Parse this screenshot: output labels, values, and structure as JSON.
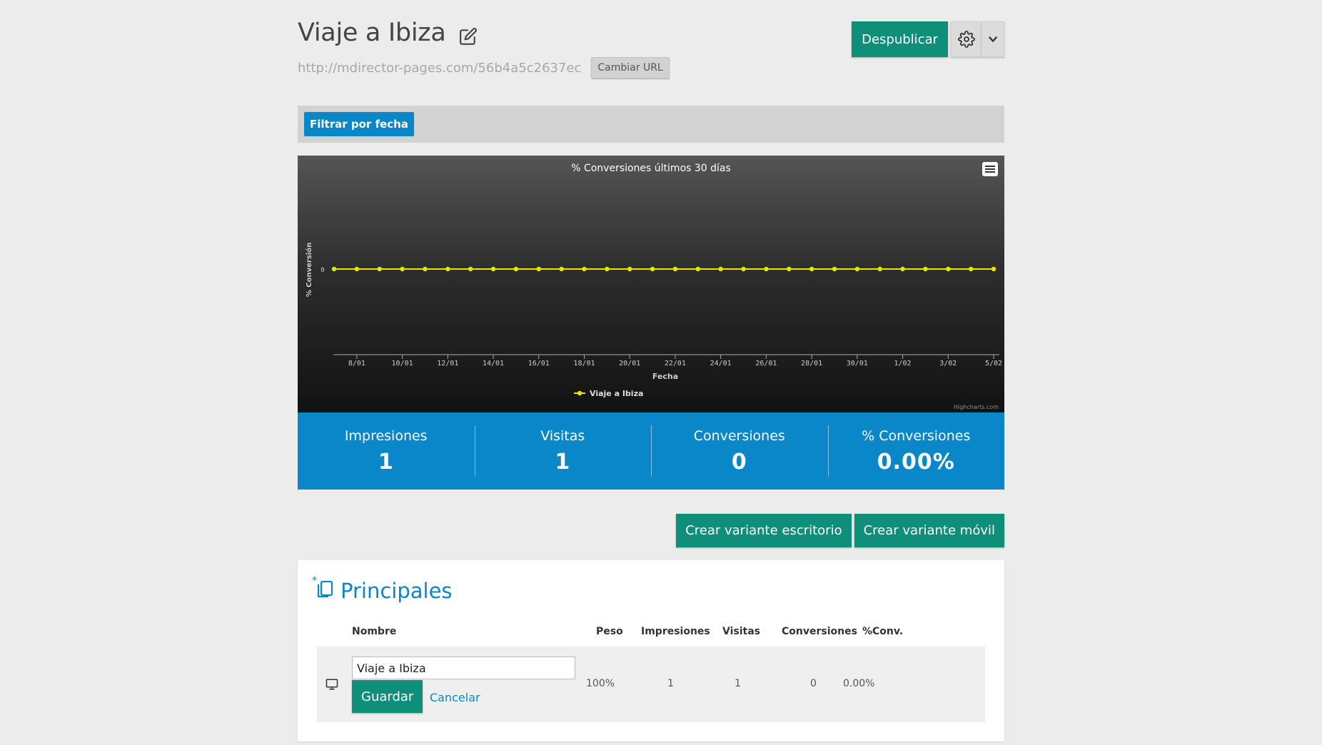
{
  "header": {
    "title": "Viaje a Ibiza",
    "url": "http://mdirector-pages.com/56b4a5c2637ec",
    "change_url_label": "Cambiar URL",
    "unpublish_label": "Despublicar"
  },
  "filter": {
    "button_label": "Filtrar por fecha"
  },
  "chart_data": {
    "type": "line",
    "title": "% Conversiones últimos 30 días",
    "xlabel": "Fecha",
    "ylabel": "% Conversión",
    "ytick": "0",
    "credits": "Highcharts.com",
    "x": [
      "7/01",
      "8/01",
      "9/01",
      "10/01",
      "11/01",
      "12/01",
      "13/01",
      "14/01",
      "15/01",
      "16/01",
      "17/01",
      "18/01",
      "19/01",
      "20/01",
      "21/01",
      "22/01",
      "23/01",
      "24/01",
      "25/01",
      "26/01",
      "27/01",
      "28/01",
      "29/01",
      "30/01",
      "31/01",
      "1/02",
      "2/02",
      "3/02",
      "4/02",
      "5/02"
    ],
    "xtick_labels": [
      "8/01",
      "10/01",
      "12/01",
      "14/01",
      "16/01",
      "18/01",
      "20/01",
      "22/01",
      "24/01",
      "26/01",
      "28/01",
      "30/01",
      "1/02",
      "3/02",
      "5/02"
    ],
    "series": [
      {
        "name": "Viaje a Ibiza",
        "color": "#e6e600",
        "values": [
          0,
          0,
          0,
          0,
          0,
          0,
          0,
          0,
          0,
          0,
          0,
          0,
          0,
          0,
          0,
          0,
          0,
          0,
          0,
          0,
          0,
          0,
          0,
          0,
          0,
          0,
          0,
          0,
          0,
          0
        ]
      }
    ],
    "legend": "bottom-center",
    "grid": false
  },
  "stats": {
    "impressions_label": "Impresiones",
    "impressions_value": "1",
    "visits_label": "Visitas",
    "visits_value": "1",
    "conversions_label": "Conversiones",
    "conversions_value": "0",
    "conv_rate_label": "% Conversiones",
    "conv_rate_value": "0.00%"
  },
  "variants": {
    "desktop_label": "Crear variante escritorio",
    "mobile_label": "Crear variante móvil"
  },
  "panel": {
    "title": "Principales",
    "columns": {
      "name": "Nombre",
      "weight": "Peso",
      "impressions": "Impresiones",
      "visits": "Visitas",
      "conversions": "Conversiones",
      "conv": "%Conv."
    },
    "rows": [
      {
        "name": "Viaje a Ibiza",
        "save_label": "Guardar",
        "cancel_label": "Cancelar",
        "weight": "100%",
        "impressions": "1",
        "visits": "1",
        "conversions": "0",
        "conv": "0.00%"
      }
    ]
  },
  "colors": {
    "green": "#0f8f79",
    "blue": "#0a87c9",
    "series_yellow": "#e6e600"
  }
}
